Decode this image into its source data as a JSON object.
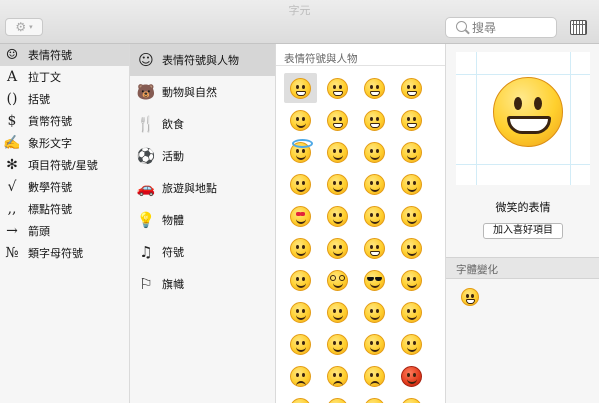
{
  "window": {
    "title": "字元"
  },
  "toolbar": {
    "gear_icon": "gear-icon",
    "search_placeholder": "搜尋",
    "keyboard_icon": "keyboard-viewer-icon"
  },
  "categories": [
    {
      "icon": "☺",
      "label": "表情符號",
      "selected": true
    },
    {
      "icon": "A",
      "label": "拉丁文",
      "selected": false
    },
    {
      "icon": "()",
      "label": "括號",
      "selected": false
    },
    {
      "icon": "$",
      "label": "貨幣符號",
      "selected": false
    },
    {
      "icon": "✍",
      "label": "象形文字",
      "selected": false
    },
    {
      "icon": "✻",
      "label": "項目符號/星號",
      "selected": false
    },
    {
      "icon": "√",
      "label": "數學符號",
      "selected": false
    },
    {
      "icon": "‚,",
      "label": "標點符號",
      "selected": false
    },
    {
      "icon": "→",
      "label": "箭頭",
      "selected": false
    },
    {
      "icon": "№",
      "label": "類字母符號",
      "selected": false
    }
  ],
  "subcategories": [
    {
      "icon": "☺",
      "label": "表情符號與人物",
      "selected": true
    },
    {
      "icon": "🐻",
      "label": "動物與自然",
      "selected": false
    },
    {
      "icon": "🍴",
      "label": "飲食",
      "selected": false
    },
    {
      "icon": "⚽",
      "label": "活動",
      "selected": false
    },
    {
      "icon": "🚗",
      "label": "旅遊與地點",
      "selected": false
    },
    {
      "icon": "💡",
      "label": "物體",
      "selected": false
    },
    {
      "icon": "♫",
      "label": "符號",
      "selected": false
    },
    {
      "icon": "⚐",
      "label": "旗幟",
      "selected": false
    }
  ],
  "grid": {
    "title": "表情符號與人物",
    "emojis": [
      "grin",
      "grin",
      "grin",
      "grin",
      "smile",
      "grin",
      "grin",
      "grin",
      "halo",
      "smile",
      "smile",
      "smile",
      "smile",
      "smile",
      "smile",
      "smile",
      "heart",
      "smile",
      "smile",
      "smile",
      "smile",
      "smile",
      "grin",
      "smile",
      "smile",
      "glasses",
      "shades",
      "smile",
      "smile",
      "smile",
      "smile",
      "smile",
      "smile",
      "smile",
      "smile",
      "smile",
      "frown",
      "frown",
      "frown",
      "angry",
      "frown",
      "frown",
      "frown",
      "frown"
    ]
  },
  "preview": {
    "name": "微笑的表情",
    "favorite_button": "加入喜好項目"
  },
  "variations": {
    "title": "字體變化"
  }
}
